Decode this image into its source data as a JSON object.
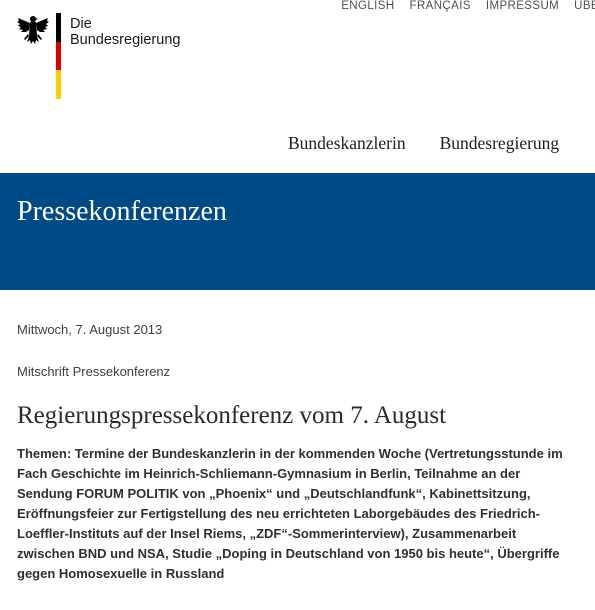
{
  "meta_nav": {
    "items": [
      "ENGLISH",
      "FRANÇAIS",
      "IMPRESSUM",
      "ÜBE"
    ]
  },
  "logo": {
    "line1": "Die",
    "line2": "Bundesregierung",
    "icon": "eagle-icon",
    "flag_colors": [
      "#000000",
      "#dd0000",
      "#ffce00"
    ]
  },
  "main_nav": {
    "items": [
      "Bundeskanzlerin",
      "Bundesregierung"
    ]
  },
  "banner": {
    "title": "Pressekonferenzen",
    "color": "#004b87"
  },
  "article": {
    "date": "Mittwoch, 7. August 2013",
    "category": "Mitschrift Pressekonferenz",
    "headline": "Regierungspressekonferenz vom 7. August",
    "themes": "Themen: Termine der Bundeskanzlerin in der kommenden Woche (Vertretungsstunde im Fach Geschichte im Heinrich-Schliemann-Gymnasium in Berlin, Teilnahme an der Sendung FORUM POLITIK von „Phoenix“ und „Deutschlandfunk“, Kabinettsitzung, Eröffnungsfeier zur Fertigstellung des neu errichteten Laborgebäudes des Friedrich-Loeffler-Instituts auf der Insel Riems, „ZDF“-Sommerinterview), Zusammenarbeit zwischen BND und NSA, Studie „Doping in Deutschland von 1950 bis heute“, Übergriffe gegen Homosexuelle in Russland"
  }
}
